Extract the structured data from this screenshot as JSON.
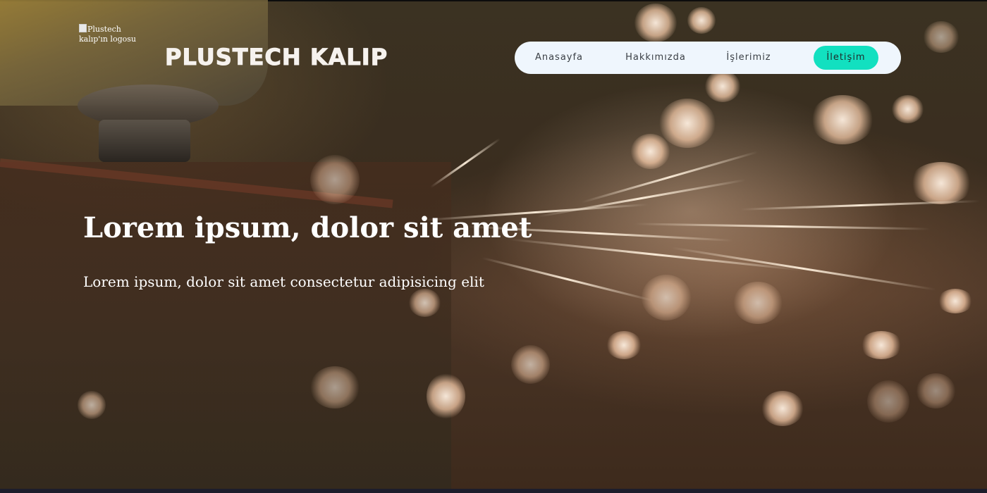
{
  "header": {
    "logo_alt": "Plustech kalıp'ın logosu",
    "brand": "PLUSTECH KALIP"
  },
  "nav": {
    "items": [
      {
        "label": "Anasayfa"
      },
      {
        "label": "Hakkımızda"
      },
      {
        "label": "İşlerimiz"
      },
      {
        "label": "İletişim",
        "active": true
      }
    ]
  },
  "hero": {
    "title": "Lorem ipsum, dolor sit amet",
    "subtitle": "Lorem ipsum, dolor sit amet consectetur adipisicing elit"
  },
  "colors": {
    "nav_background": "#eff6fd",
    "nav_active": "#12e0c0",
    "text_light": "#ffffff"
  }
}
